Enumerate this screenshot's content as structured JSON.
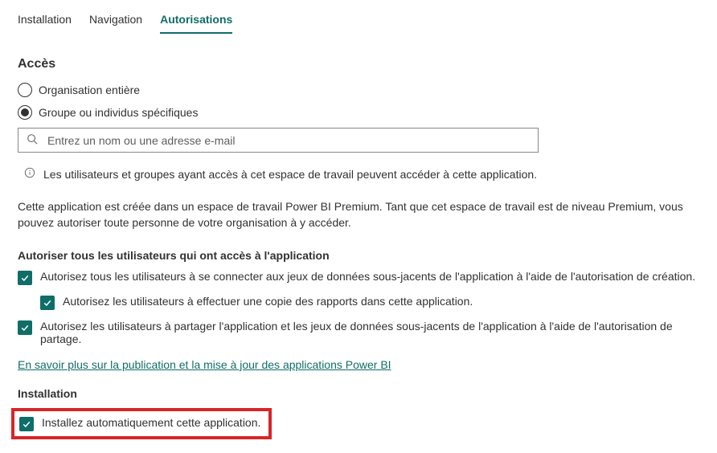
{
  "tabs": {
    "installation": "Installation",
    "navigation": "Navigation",
    "autorisations": "Autorisations"
  },
  "access": {
    "title": "Accès",
    "radio_org": "Organisation entière",
    "radio_group": "Groupe ou individus spécifiques",
    "search_placeholder": "Entrez un nom ou une adresse e-mail",
    "info_text": "Les utilisateurs et groupes ayant accès à cet espace de travail peuvent accéder à cette application.",
    "premium_note": "Cette application est créée dans un espace de travail Power BI Premium. Tant que cet espace de travail est de niveau Premium, vous pouvez autoriser toute personne de votre organisation à y accéder."
  },
  "allow_users": {
    "title": "Autoriser tous les utilisateurs qui ont accès à l'application",
    "cb_datasets": "Autorisez tous les utilisateurs à se connecter aux jeux de données sous-jacents de l'application à l'aide de l'autorisation de création.",
    "cb_copy": "Autorisez les utilisateurs à effectuer une copie des rapports dans cette application.",
    "cb_share": "Autorisez les utilisateurs à partager l'application et les jeux de données sous-jacents de l'application à l'aide de l'autorisation de partage.",
    "learn_more": "En savoir plus sur la publication et la mise à jour des applications Power BI"
  },
  "installation": {
    "title": "Installation",
    "cb_auto": "Installez automatiquement cette application."
  }
}
